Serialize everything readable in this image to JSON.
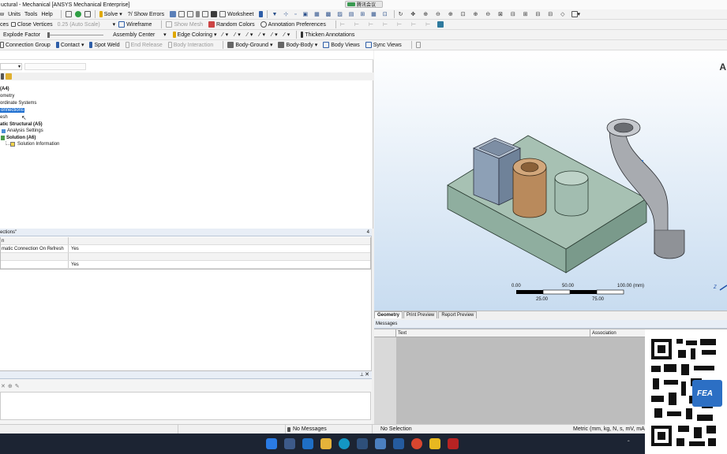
{
  "window": {
    "title": "uctural - Mechanical [ANSYS Mechanical Enterprise]",
    "meeting_badge": "腾讯会议"
  },
  "menu": [
    "w",
    "Units",
    "Tools",
    "Help"
  ],
  "toolbar1": {
    "solve": "Solve",
    "show_errors": "?/ Show Errors",
    "worksheet": "Worksheet"
  },
  "toolbar2": {
    "ces": "ces",
    "close_vertices": "Close Vertices",
    "auto_scale": "0.25 (Auto Scale)",
    "wireframe": "Wireframe",
    "show_mesh": "Show Mesh",
    "random_colors": "Random Colors",
    "annotation_preferences": "Annotation Preferences"
  },
  "toolbar3": {
    "explode_factor": "Explode Factor",
    "assembly_center": "Assembly Center",
    "edge_coloring": "Edge Coloring",
    "thicken_annotations": "Thicken Annotations"
  },
  "toolbar4": {
    "connection_group": "Connection Group",
    "contact": "Contact",
    "spot_weld": "Spot Weld",
    "end_release": "End Release",
    "body_interaction": "Body Interaction",
    "body_ground": "Body-Ground",
    "body_body": "Body-Body",
    "body_views": "Body Views",
    "sync_views": "Sync Views"
  },
  "tree": {
    "items": [
      {
        "label": "(A4)",
        "bold": true
      },
      {
        "label": "ometry",
        "bold": false
      },
      {
        "label": "ordinate Systems",
        "bold": false
      },
      {
        "label": "onnections",
        "bold": false,
        "selected": true
      },
      {
        "label": "esh",
        "bold": false
      },
      {
        "label": "atic Structural (A5)",
        "bold": true
      },
      {
        "label": "Analysis Settings",
        "bold": false
      },
      {
        "label": "Solution (A6)",
        "bold": true
      },
      {
        "label": "Solution Information",
        "bold": false
      }
    ]
  },
  "details": {
    "title": "ections\"",
    "pin": "4",
    "rows": [
      {
        "label": "n",
        "value": ""
      },
      {
        "label": "matic Connection On Refresh",
        "value": "Yes"
      },
      {
        "label": "",
        "value": ""
      },
      {
        "label": "",
        "value": "Yes"
      }
    ]
  },
  "viewport": {
    "corner_letter": "A",
    "scale": {
      "top_labels": [
        "0.00",
        "50.00",
        "100.00 (mm)"
      ],
      "bottom_labels": [
        "25.00",
        "75.00"
      ]
    },
    "axis_letter": "Z",
    "tabs": [
      "Geometry",
      "Print Preview",
      "Report Preview"
    ]
  },
  "messages": {
    "title": "Messages",
    "columns": [
      "Text",
      "Association"
    ]
  },
  "status": {
    "messages": "No Messages",
    "selection": "No Selection",
    "units": "Metric (mm, kg, N, s, mV, mA)"
  },
  "qr": {
    "badge": "FEA"
  },
  "colors": {
    "viewport_top": "#ffffff",
    "viewport_bottom": "#c8dcf0",
    "selection": "#1e6fd0",
    "plate": "#a3bdb0",
    "cylinder_copper": "#b98a5c"
  }
}
